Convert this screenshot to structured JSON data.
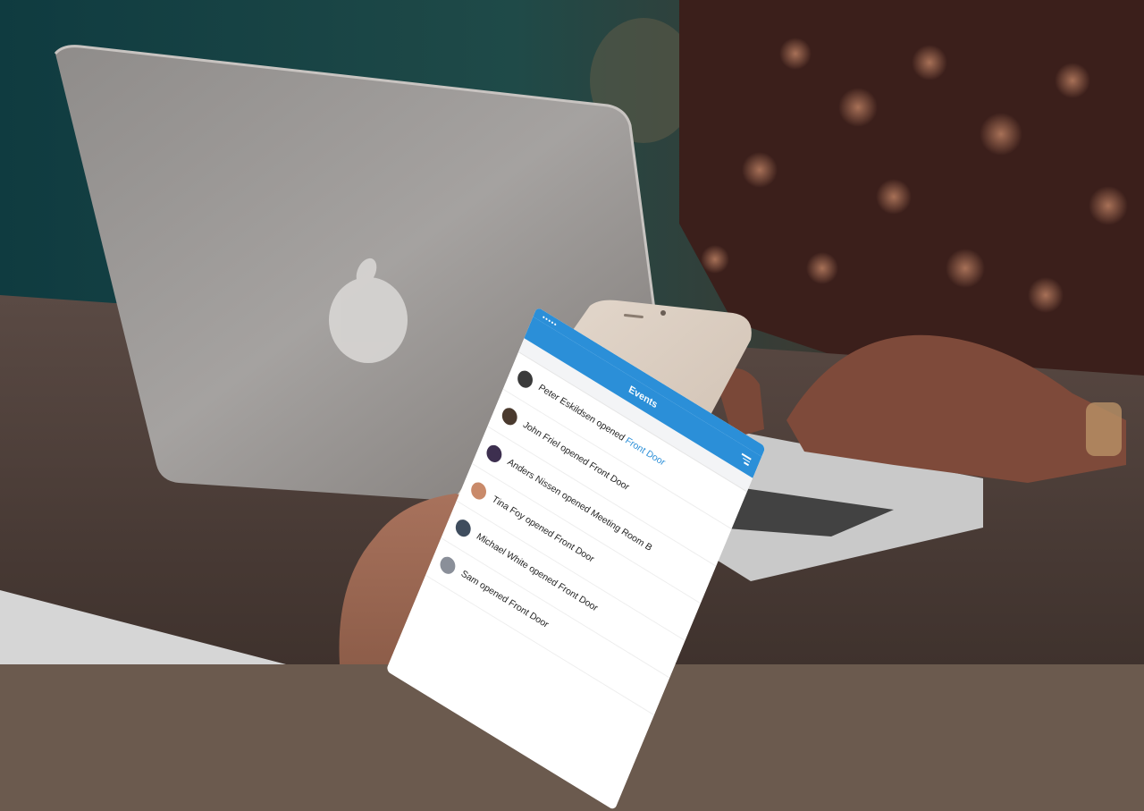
{
  "app": {
    "status_bar": {
      "carrier": "•••••",
      "time": "",
      "battery": ""
    },
    "nav": {
      "title": "Events"
    },
    "section": {
      "label": ""
    },
    "events": [
      {
        "text": "Peter Eskildsen opened ",
        "place": "Front Door",
        "avatar_color": "#3a3a3a",
        "time": ""
      },
      {
        "text": "John Friel opened Front Door",
        "place": "",
        "avatar_color": "#4a3a2e",
        "time": ""
      },
      {
        "text": "Anders Nissen opened Meeting Room B",
        "place": "",
        "avatar_color": "#3d2f4f",
        "time": ""
      },
      {
        "text": "Tina Foy opened Front Door",
        "place": "",
        "avatar_color": "#c98a6a",
        "time": ""
      },
      {
        "text": "Michael White opened Front Door",
        "place": "",
        "avatar_color": "#3f4d5e",
        "time": ""
      },
      {
        "text": "Sam opened Front Door",
        "place": "",
        "avatar_color": "#8a8f99",
        "time": ""
      }
    ]
  },
  "colors": {
    "accent": "#2b8fd8"
  }
}
